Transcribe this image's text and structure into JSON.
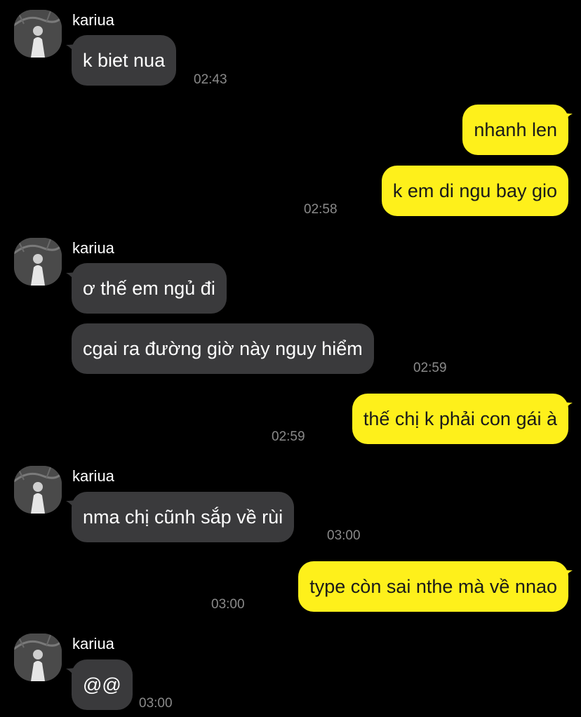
{
  "chat": {
    "contact_name": "kariua",
    "colors": {
      "background": "#000000",
      "incoming_bubble": "#3a3a3c",
      "outgoing_bubble": "#fef01b",
      "timestamp": "#8a8a8a"
    },
    "groups": [
      {
        "sender": "kariua",
        "messages": [
          "k biet nua"
        ],
        "time": "02:43"
      },
      {
        "sender": "me",
        "messages": [
          "nhanh len",
          "k em di ngu bay gio"
        ],
        "time": "02:58"
      },
      {
        "sender": "kariua",
        "messages": [
          "ơ thế em ngủ đi",
          "cgai ra đường giờ này nguy hiểm"
        ],
        "time": "02:59"
      },
      {
        "sender": "me",
        "messages": [
          "thế chị k phải con gái à"
        ],
        "time": "02:59"
      },
      {
        "sender": "kariua",
        "messages": [
          "nma chị cũnh sắp về rùi"
        ],
        "time": "03:00"
      },
      {
        "sender": "me",
        "messages": [
          "type còn sai nthe mà về nnao"
        ],
        "time": "03:00"
      },
      {
        "sender": "kariua",
        "messages": [
          "@@"
        ],
        "time": "03:00"
      }
    ]
  }
}
